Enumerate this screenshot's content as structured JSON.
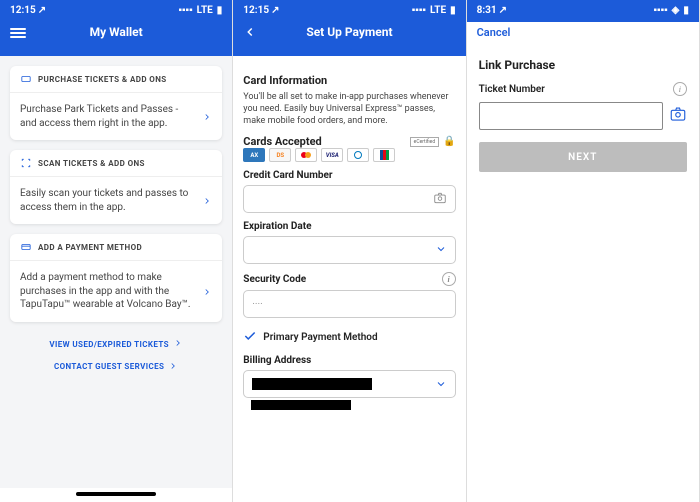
{
  "screen1": {
    "status": {
      "time": "12:15",
      "network": "LTE"
    },
    "header": {
      "title": "My Wallet"
    },
    "cards": [
      {
        "title": "PURCHASE TICKETS & ADD ONS",
        "desc": "Purchase Park Tickets and Passes - and access them right in the app."
      },
      {
        "title": "SCAN TICKETS & ADD ONS",
        "desc": "Easily scan your tickets and passes to access them in the app."
      },
      {
        "title": "ADD A PAYMENT METHOD",
        "desc": "Add a payment method to make purchases in the app and with the TapuTapu™ wearable at Volcano Bay™."
      }
    ],
    "links": {
      "expired": "VIEW USED/EXPIRED TICKETS",
      "contact": "CONTACT GUEST SERVICES"
    }
  },
  "screen2": {
    "status": {
      "time": "12:15",
      "network": "LTE"
    },
    "header": {
      "title": "Set Up Payment"
    },
    "section": {
      "title": "Card Information",
      "desc": "You'll be all set to make in-app purchases whenever you need. Easily buy Universal Express™ passes, make mobile food orders, and more.",
      "accepted_label": "Cards Accepted",
      "certified": "eCertified"
    },
    "fields": {
      "cc_label": "Credit Card Number",
      "exp_label": "Expiration Date",
      "sec_label": "Security Code",
      "sec_placeholder": "····",
      "primary_label": "Primary Payment Method",
      "billing_label": "Billing Address"
    },
    "card_brands": [
      "AMEX",
      "DISCOVER",
      "MC",
      "VISA",
      "DINERS",
      "JCB"
    ]
  },
  "screen3": {
    "status": {
      "time": "8:31"
    },
    "header": {
      "cancel": "Cancel"
    },
    "title": "Link Purchase",
    "ticket_label": "Ticket Number",
    "next": "NEXT"
  }
}
